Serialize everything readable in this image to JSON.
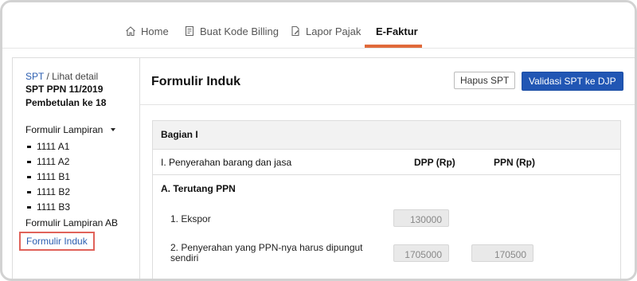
{
  "nav": {
    "items": [
      {
        "label": "Home",
        "icon": "home-icon"
      },
      {
        "label": "Buat Kode Billing",
        "icon": "receipt-icon"
      },
      {
        "label": "Lapor Pajak",
        "icon": "document-edit-icon"
      },
      {
        "label": "E-Faktur",
        "icon": ""
      }
    ],
    "active": "E-Faktur",
    "accent_color": "#e06a3a"
  },
  "sidebar": {
    "breadcrumb_link": "SPT",
    "breadcrumb_rest": "/ Lihat detail",
    "spt_title": "SPT PPN 11/2019",
    "spt_subtitle": "Pembetulan ke 18",
    "lampiran_label": "Formulir Lampiran",
    "lampiran_items": [
      "1111 A1",
      "1111 A2",
      "1111 B1",
      "1111 B2",
      "1111 B3"
    ],
    "lampiran_ab": "Formulir Lampiran AB",
    "induk_link": "Formulir Induk"
  },
  "main": {
    "title": "Formulir Induk",
    "hapus_label": "Hapus SPT",
    "validasi_label": "Validasi SPT ke DJP",
    "primary_color": "#2156b4",
    "section_title": "Bagian I",
    "row_label": "I. Penyerahan barang dan jasa",
    "col_dpp": "DPP (Rp)",
    "col_ppn": "PPN (Rp)",
    "subsection": "A. Terutang PPN",
    "items": [
      {
        "label": "1. Ekspor",
        "dpp": "130000",
        "ppn": ""
      },
      {
        "label_line1": "2. Penyerahan yang PPN-nya harus dipungut",
        "label_line2": "sendiri",
        "dpp": "1705000",
        "ppn": "170500"
      }
    ]
  }
}
